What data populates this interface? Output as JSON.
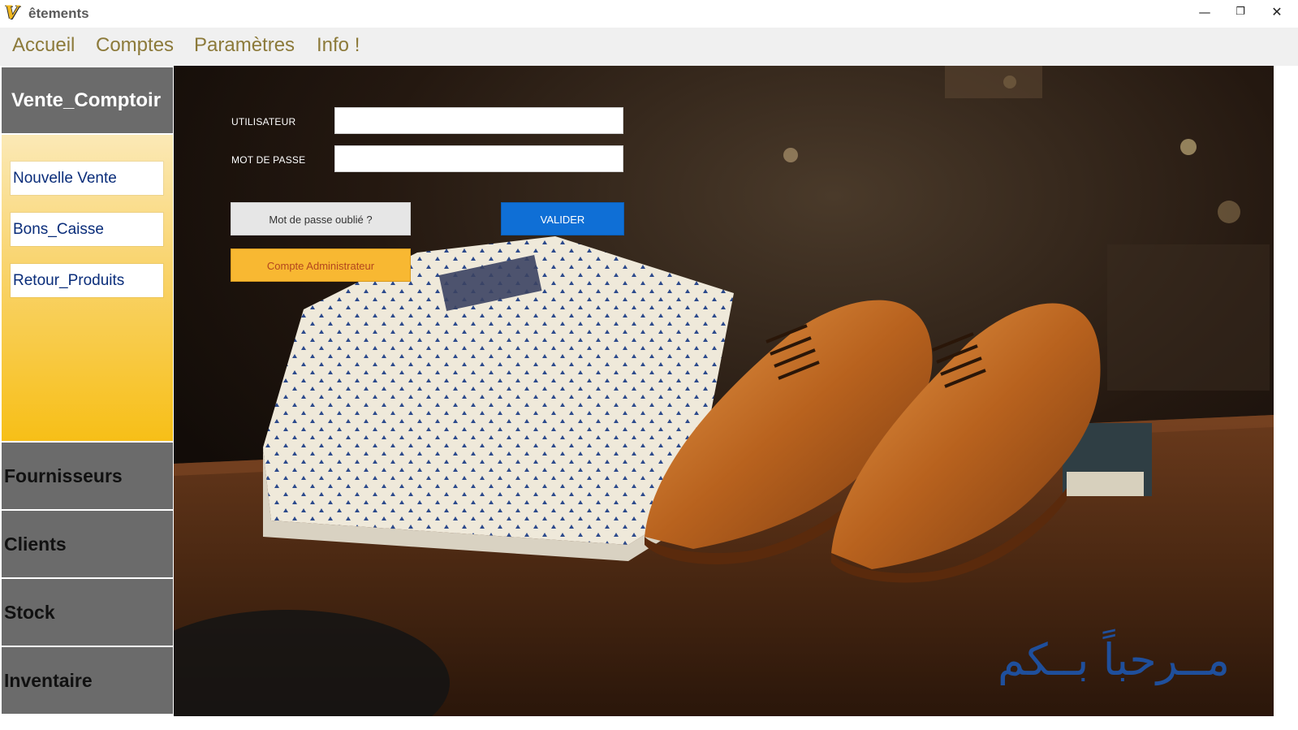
{
  "window": {
    "title": "êtements",
    "controls": {
      "minimize": "—",
      "maximize": "❐",
      "close": "✕"
    }
  },
  "menu": {
    "items": [
      "Accueil",
      "Comptes",
      "Paramètres",
      "Info !"
    ]
  },
  "sidebar": {
    "header": "Vente_Comptoir",
    "sub_items": [
      "Nouvelle Vente",
      "Bons_Caisse",
      "Retour_Produits"
    ],
    "sections": [
      "Fournisseurs",
      "Clients",
      "Stock",
      "Inventaire"
    ]
  },
  "login": {
    "user_label": "UTILISATEUR",
    "user_value": "",
    "password_label": "MOT DE PASSE",
    "password_value": "",
    "forgot_label": "Mot de passe oublié ?",
    "validate_label": "VALIDER",
    "admin_label": "Compte Administrateur"
  },
  "welcome_text": "مــرحباً بــكم",
  "colors": {
    "accent_blue": "#0f6fd6",
    "accent_orange": "#f8b832",
    "sidebar_gray": "#6b6b6b",
    "menu_text": "#8c7a3a"
  }
}
